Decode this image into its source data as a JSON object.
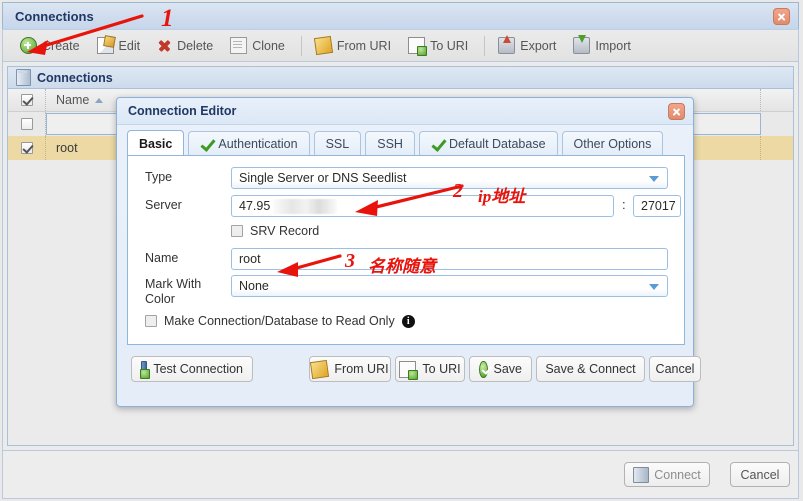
{
  "window": {
    "title": "Connections",
    "close_icon": "close-icon"
  },
  "toolbar": {
    "items": [
      {
        "label": "Create",
        "icon": "create-icon"
      },
      {
        "label": "Edit",
        "icon": "edit-icon"
      },
      {
        "label": "Delete",
        "icon": "delete-icon"
      },
      {
        "label": "Clone",
        "icon": "clone-icon"
      },
      {
        "label": "From URI",
        "icon": "from-uri-icon"
      },
      {
        "label": "To URI",
        "icon": "to-uri-icon"
      },
      {
        "label": "Export",
        "icon": "export-icon"
      },
      {
        "label": "Import",
        "icon": "import-icon"
      }
    ]
  },
  "grid": {
    "header_title": "Connections",
    "header_icon": "database-icon",
    "columns": [
      "Name"
    ],
    "sort_indicator": "ascending",
    "rows": [
      {
        "checked": true,
        "name": "",
        "selected": false,
        "editing": true
      },
      {
        "checked": true,
        "name": "root",
        "selected": true,
        "editing": false
      }
    ]
  },
  "bottom_bar": {
    "connect_label": "Connect",
    "cancel_label": "Cancel"
  },
  "dialog": {
    "title": "Connection Editor",
    "close_icon": "close-icon",
    "tabs": [
      {
        "label": "Basic",
        "active": true,
        "icon": null
      },
      {
        "label": "Authentication",
        "active": false,
        "icon": "green-check-icon"
      },
      {
        "label": "SSL",
        "active": false,
        "icon": null
      },
      {
        "label": "SSH",
        "active": false,
        "icon": null
      },
      {
        "label": "Default Database",
        "active": false,
        "icon": "green-check-icon"
      },
      {
        "label": "Other Options",
        "active": false,
        "icon": null
      }
    ],
    "fields": {
      "type_label": "Type",
      "type_value": "Single Server or DNS Seedlist",
      "server_label": "Server",
      "server_value": "47.95",
      "server_redacted": true,
      "port_separator": ":",
      "port_value": "27017",
      "srv_label": "SRV Record",
      "srv_checked": false,
      "name_label": "Name",
      "name_value": "root",
      "mark_label": "Mark With Color",
      "mark_value": "None",
      "readonly_label": "Make Connection/Database to Read Only",
      "readonly_checked": false,
      "readonly_info_icon": "info-icon"
    },
    "buttons": [
      {
        "label": "Test Connection",
        "icon": "test-connection-icon"
      },
      {
        "label": "From URI",
        "icon": "from-uri-icon"
      },
      {
        "label": "To URI",
        "icon": "to-uri-icon"
      },
      {
        "label": "Save",
        "icon": "green-check-circle-icon"
      },
      {
        "label": "Save & Connect",
        "icon": null
      },
      {
        "label": "Cancel",
        "icon": null
      }
    ]
  },
  "annotations": {
    "color": "#e8140c",
    "items": [
      {
        "id": "1",
        "text": "1",
        "target": "create-button"
      },
      {
        "id": "2",
        "text": "2   ip地址",
        "target": "server-field"
      },
      {
        "id": "3",
        "text": "3  名称随意",
        "target": "name-field"
      }
    ],
    "one": "1",
    "two": "2",
    "two_text": "ip地址",
    "three": "3",
    "three_text": "名称随意"
  }
}
